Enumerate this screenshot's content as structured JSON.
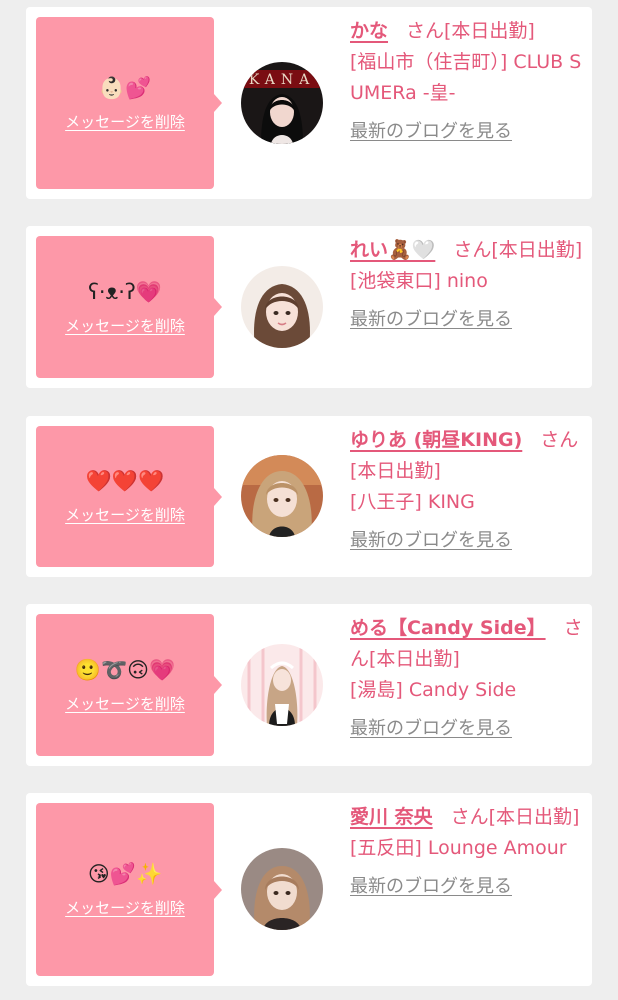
{
  "colors": {
    "page_background": "#eeeeee",
    "card_background": "#ffffff",
    "bubble_pink": "#fd98a8",
    "name_pink": "#e4587a",
    "blog_gray": "#8a8a8a"
  },
  "messages": [
    {
      "emoji": "👶🏻💕",
      "delete_label": "メッセージを削除",
      "avatar_icon": "cast-photo-icon",
      "name": "かな",
      "suffix": "さん[本日出勤]",
      "shop": "[福山市（住吉町）] CLUB SUMERa -皇-",
      "blog_label": "最新のブログを見る"
    },
    {
      "emoji": "ʕ·ᴥ·ʔ💗",
      "delete_label": "メッセージを削除",
      "avatar_icon": "cast-photo-icon",
      "name": "れい🧸🤍",
      "suffix": "さん[本日出勤]",
      "shop": "[池袋東口] nino",
      "blog_label": "最新のブログを見る"
    },
    {
      "emoji": "❤️❤️❤️",
      "delete_label": "メッセージを削除",
      "avatar_icon": "cast-photo-icon",
      "name": "ゆりあ (朝昼KING)",
      "suffix": "さん[本日出勤]",
      "shop": "[八王子] KING",
      "blog_label": "最新のブログを見る"
    },
    {
      "emoji": "🙂➰🙃💗",
      "delete_label": "メッセージを削除",
      "avatar_icon": "cast-photo-icon",
      "name": "める【Candy Side】",
      "suffix": "さん[本日出勤]",
      "shop": "[湯島] Candy Side",
      "blog_label": "最新のブログを見る"
    },
    {
      "emoji": "😘💕✨",
      "delete_label": "メッセージを削除",
      "avatar_icon": "cast-photo-icon",
      "name": "愛川 奈央",
      "suffix": "さん[本日出勤]",
      "shop": "[五反田] Lounge Amour",
      "blog_label": "最新のブログを見る"
    }
  ]
}
